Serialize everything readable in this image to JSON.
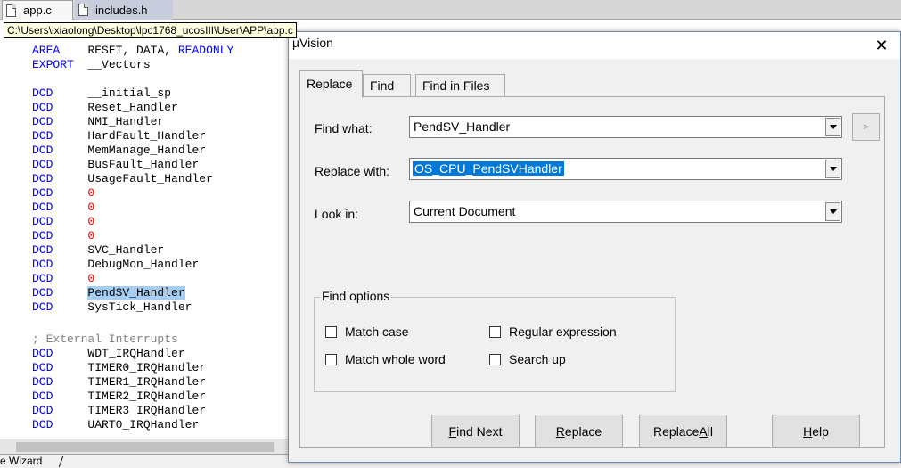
{
  "file_tabs": [
    {
      "label": "app.c",
      "active": true
    },
    {
      "label": "includes.h",
      "active": false
    }
  ],
  "path_tooltip": "C:\\Users\\ixiaolong\\Desktop\\lpc1768_ucosIII\\User\\APP\\app.c",
  "code": {
    "area_kw": "AREA",
    "area_args": "RESET, DATA, ",
    "area_readonly": "READONLY",
    "export_kw": "EXPORT",
    "export_name": "__Vectors",
    "dcd_kw": "DCD",
    "vectors": [
      "__initial_sp",
      "Reset_Handler",
      "NMI_Handler",
      "HardFault_Handler",
      "MemManage_Handler",
      "BusFault_Handler",
      "UsageFault_Handler",
      "0",
      "0",
      "0",
      "0",
      "SVC_Handler",
      "DebugMon_Handler",
      "0",
      "PendSV_Handler",
      "SysTick_Handler"
    ],
    "comment": "; External Interrupts",
    "external": [
      "WDT_IRQHandler",
      "TIMER0_IRQHandler",
      "TIMER1_IRQHandler",
      "TIMER2_IRQHandler",
      "TIMER3_IRQHandler",
      "UART0_IRQHandler"
    ]
  },
  "bottom_tab": "e Wizard",
  "dialog": {
    "title": "µVision",
    "close": "✕",
    "tabs": [
      "Replace",
      "Find",
      "Find in Files"
    ],
    "find_what_label": "Find what:",
    "find_what_value": "PendSV_Handler",
    "replace_with_label": "Replace with:",
    "replace_with_value": "OS_CPU_PendSVHandler",
    "look_in_label": "Look in:",
    "look_in_value": "Current Document",
    "more_button": ">",
    "find_options_title": "Find options",
    "options": {
      "match_case": "Match case",
      "regular_expression": "Regular expression",
      "match_whole_word": "Match whole word",
      "search_up": "Search up"
    },
    "buttons": {
      "find_next_pre": "",
      "find_next_key": "F",
      "find_next_post": "ind Next",
      "replace_pre": "",
      "replace_key": "R",
      "replace_post": "eplace",
      "replace_all_pre": "Replace ",
      "replace_all_key": "A",
      "replace_all_post": "ll",
      "help_pre": "",
      "help_key": "H",
      "help_post": "elp"
    }
  }
}
